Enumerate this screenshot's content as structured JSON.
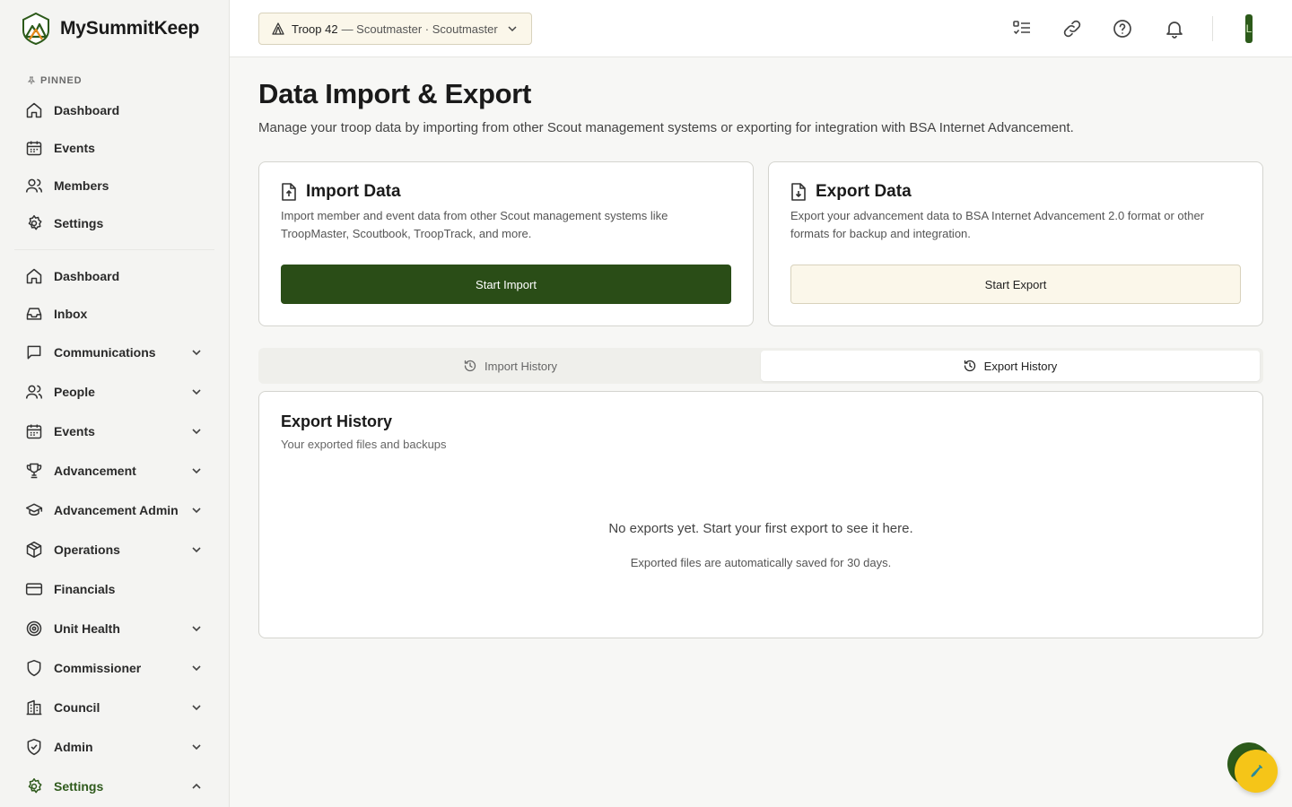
{
  "brand": {
    "name": "MySummitKeep"
  },
  "sidebar": {
    "pinned_label": "PINNED",
    "pinned": [
      {
        "label": "Dashboard",
        "icon": "home-icon"
      },
      {
        "label": "Events",
        "icon": "calendar-icon"
      },
      {
        "label": "Members",
        "icon": "users-icon"
      },
      {
        "label": "Settings",
        "icon": "gear-icon"
      }
    ],
    "items": [
      {
        "label": "Dashboard",
        "icon": "home-icon",
        "expandable": false
      },
      {
        "label": "Inbox",
        "icon": "inbox-icon",
        "expandable": false
      },
      {
        "label": "Communications",
        "icon": "message-icon",
        "expandable": true
      },
      {
        "label": "People",
        "icon": "users-icon",
        "expandable": true
      },
      {
        "label": "Events",
        "icon": "calendar-icon",
        "expandable": true
      },
      {
        "label": "Advancement",
        "icon": "trophy-icon",
        "expandable": true
      },
      {
        "label": "Advancement Admin",
        "icon": "graduation-cap-icon",
        "expandable": true
      },
      {
        "label": "Operations",
        "icon": "package-icon",
        "expandable": true
      },
      {
        "label": "Financials",
        "icon": "credit-card-icon",
        "expandable": false
      },
      {
        "label": "Unit Health",
        "icon": "target-icon",
        "expandable": true
      },
      {
        "label": "Commissioner",
        "icon": "shield-icon",
        "expandable": true
      },
      {
        "label": "Council",
        "icon": "building-icon",
        "expandable": true
      },
      {
        "label": "Admin",
        "icon": "shield-check-icon",
        "expandable": true
      },
      {
        "label": "Settings",
        "icon": "gear-icon",
        "expandable": true,
        "expanded": true
      }
    ]
  },
  "header": {
    "troop_main": "Troop 42",
    "troop_sub": "— Scoutmaster · Scoutmaster",
    "avatar_initial": "L"
  },
  "page": {
    "title": "Data Import & Export",
    "description": "Manage your troop data by importing from other Scout management systems or exporting for integration with BSA Internet Advancement."
  },
  "import_card": {
    "title": "Import Data",
    "description": "Import member and event data from other Scout management systems like TroopMaster, Scoutbook, TroopTrack, and more.",
    "button": "Start Import"
  },
  "export_card": {
    "title": "Export Data",
    "description": "Export your advancement data to BSA Internet Advancement 2.0 format or other formats for backup and integration.",
    "button": "Start Export"
  },
  "tabs": {
    "import": "Import History",
    "export": "Export History",
    "active": "export"
  },
  "history": {
    "title": "Export History",
    "subtitle": "Your exported files and backups",
    "empty_main": "No exports yet. Start your first export to see it here.",
    "empty_sub": "Exported files are automatically saved for 30 days."
  },
  "colors": {
    "primary": "#2a4d17",
    "accent_cream": "#fbf7ea",
    "fab_yellow": "#f5c518"
  }
}
